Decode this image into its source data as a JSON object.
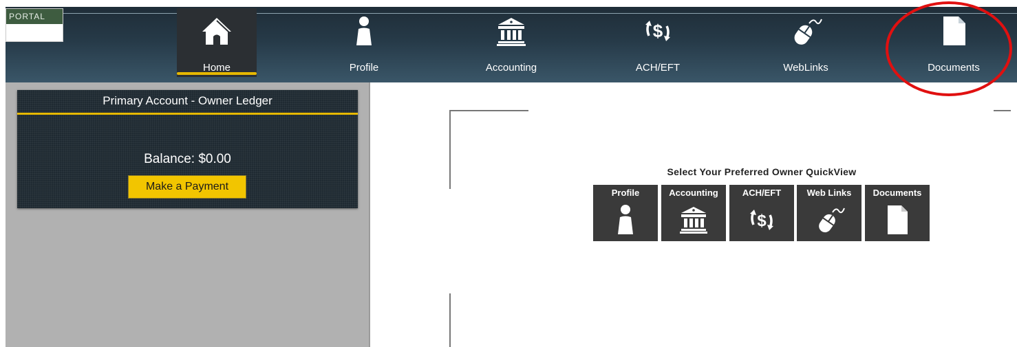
{
  "logo": {
    "text": "PORTAL"
  },
  "nav": {
    "items": [
      {
        "label": "Home",
        "icon": "home-icon",
        "active": true
      },
      {
        "label": "Profile",
        "icon": "person-icon"
      },
      {
        "label": "Accounting",
        "icon": "bank-icon"
      },
      {
        "label": "ACH/EFT",
        "icon": "dollar-exchange-icon"
      },
      {
        "label": "WebLinks",
        "icon": "mouse-icon"
      },
      {
        "label": "Documents",
        "icon": "document-icon"
      }
    ]
  },
  "account": {
    "title": "Primary Account - Owner Ledger",
    "balance": "Balance: $0.00",
    "pay_label": "Make a Payment"
  },
  "quickview": {
    "title": "Select Your Preferred Owner QuickView",
    "tiles": [
      {
        "label": "Profile",
        "icon": "person-icon"
      },
      {
        "label": "Accounting",
        "icon": "bank-icon"
      },
      {
        "label": "ACH/EFT",
        "icon": "dollar-exchange-icon"
      },
      {
        "label": "Web Links",
        "icon": "mouse-icon"
      },
      {
        "label": "Documents",
        "icon": "document-icon"
      }
    ]
  },
  "colors": {
    "accent": "#e6b800",
    "pay_button": "#f2c500",
    "nav_dark": "#1f2d38",
    "tile_bg": "#3a3a3a",
    "annotation": "#e01010"
  }
}
